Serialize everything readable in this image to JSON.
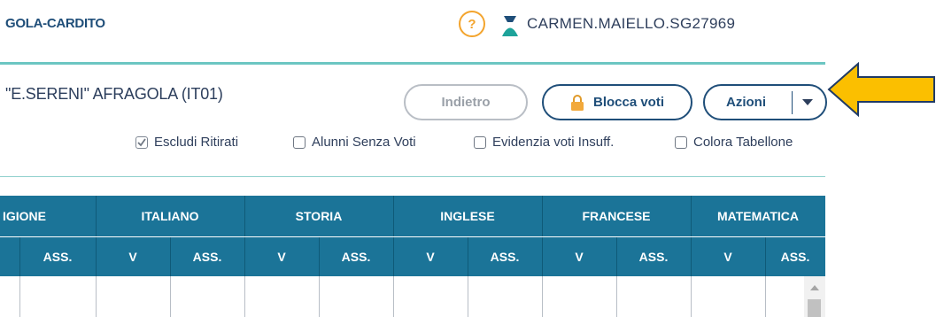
{
  "header": {
    "school_name": "GOLA-CARDITO",
    "help_label": "?",
    "user_name": "CARMEN.MAIELLO.SG27969"
  },
  "toolbar": {
    "class_title": "\"E.SERENI\" AFRAGOLA (IT01)",
    "back_label": "Indietro",
    "lock_label": "Blocca voti",
    "actions_label": "Azioni"
  },
  "options": [
    {
      "label": "Escludi Ritirati",
      "checked": true
    },
    {
      "label": "Alunni Senza Voti",
      "checked": false
    },
    {
      "label": "Evidenzia voti Insuff.",
      "checked": false
    },
    {
      "label": "Colora Tabellone",
      "checked": false
    }
  ],
  "table": {
    "subjects": [
      "IGIONE",
      "ITALIANO",
      "STORIA",
      "INGLESE",
      "FRANCESE",
      "MATEMATICA"
    ],
    "subheaders": [
      "ASS.",
      "V",
      "ASS.",
      "V",
      "ASS.",
      "V",
      "ASS.",
      "V",
      "ASS.",
      "V",
      "ASS."
    ]
  },
  "colors": {
    "accent": "#1f4e79",
    "teal": "#6cc6c2",
    "header_bg": "#1b7498",
    "help": "#f3a42d",
    "arrow": "#fbbf00"
  },
  "icons": [
    "help-icon",
    "user-icon",
    "lock-icon",
    "caret-down-icon",
    "check-icon",
    "pointer-arrow-icon",
    "scroll-up-icon"
  ]
}
